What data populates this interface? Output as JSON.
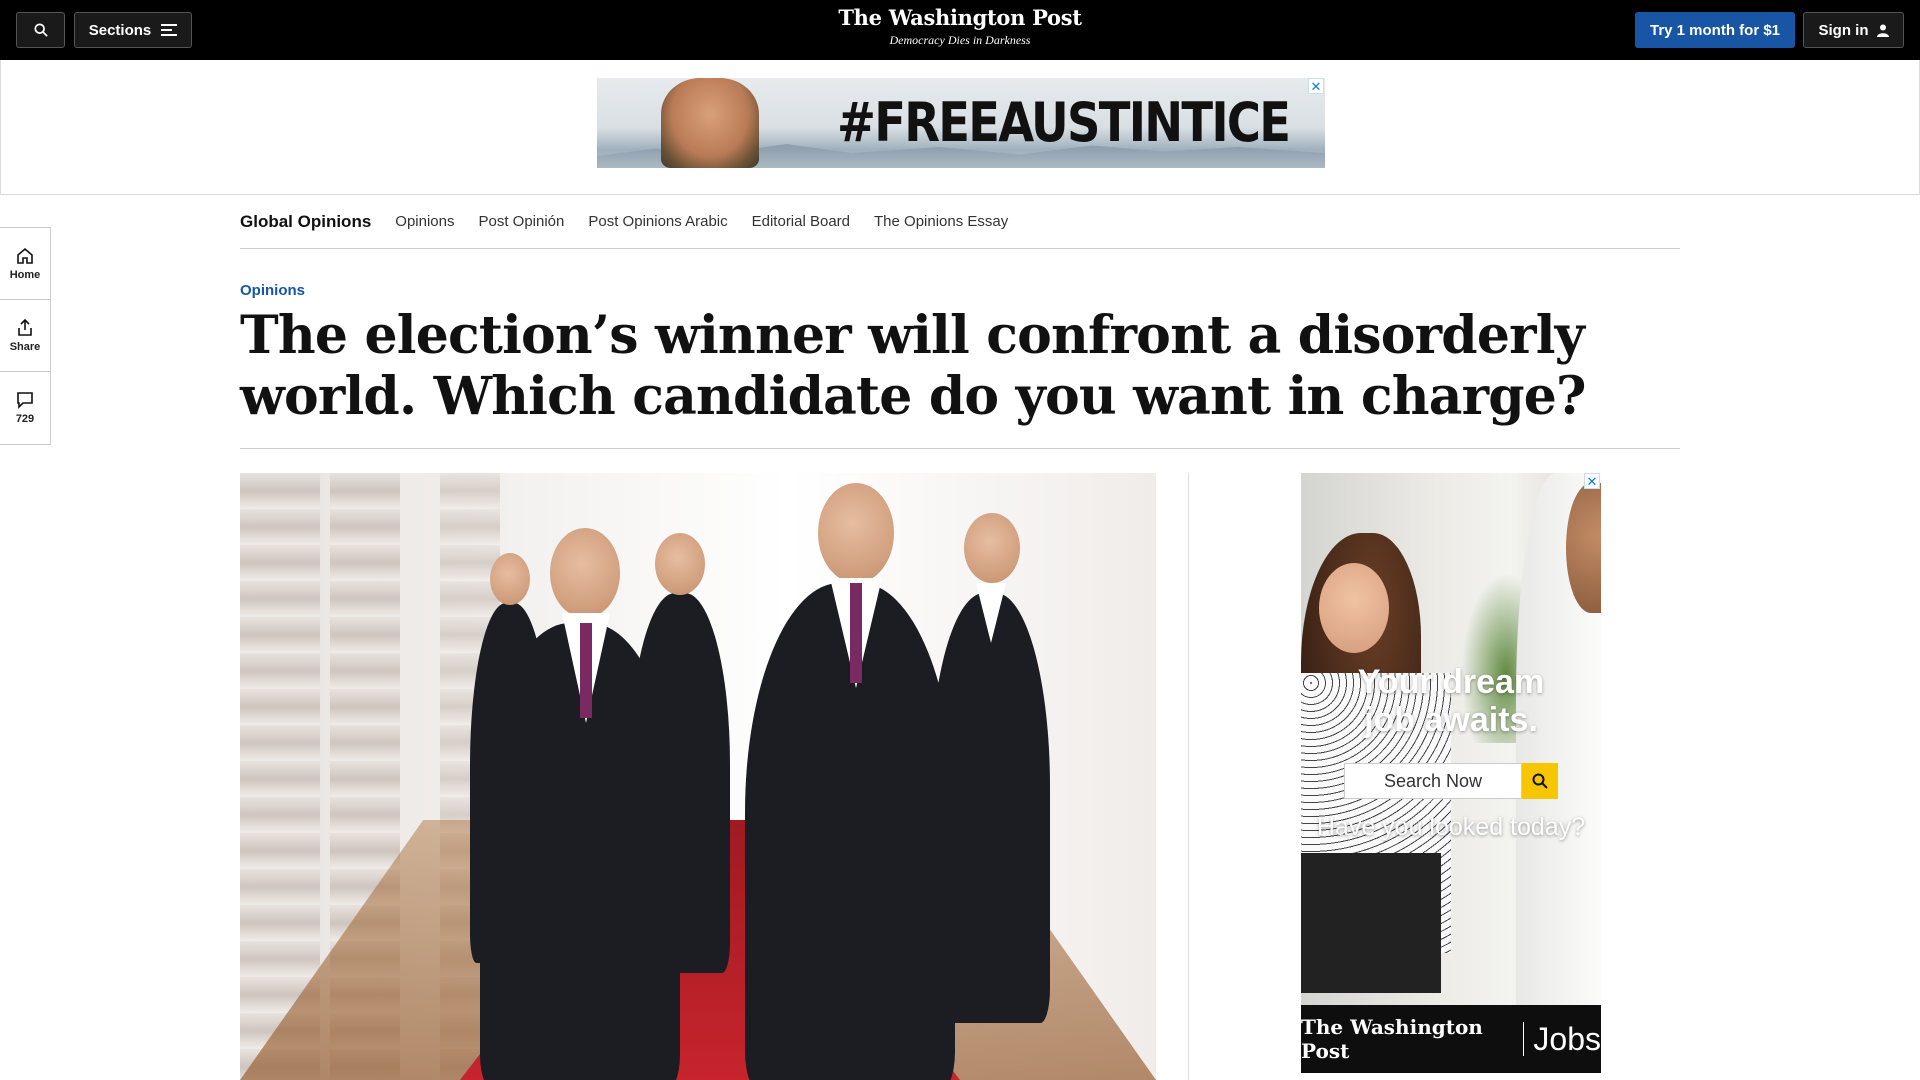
{
  "header": {
    "sections_label": "Sections",
    "logo": "The Washington Post",
    "tagline": "Democracy Dies in Darkness",
    "try_label": "Try 1 month for $1",
    "signin_label": "Sign in"
  },
  "top_ad": {
    "headline": "#FREEAUSTINTICE",
    "close": "✕"
  },
  "subnav": {
    "brand": "Global Opinions",
    "items": [
      "Opinions",
      "Post Opinión",
      "Post Opinions Arabic",
      "Editorial Board",
      "The Opinions Essay"
    ]
  },
  "rail": {
    "home": "Home",
    "share": "Share",
    "comments": "729"
  },
  "article": {
    "kicker": "Opinions",
    "title": "The election’s winner will confront a disorderly world. Which candidate do you want in charge?"
  },
  "right_ad": {
    "line1": "Your dream",
    "line2": "job awaits.",
    "search_placeholder": "Search Now",
    "question": "Have you looked today?",
    "brand": "The Washington Post",
    "product": "Jobs",
    "close": "✕"
  }
}
